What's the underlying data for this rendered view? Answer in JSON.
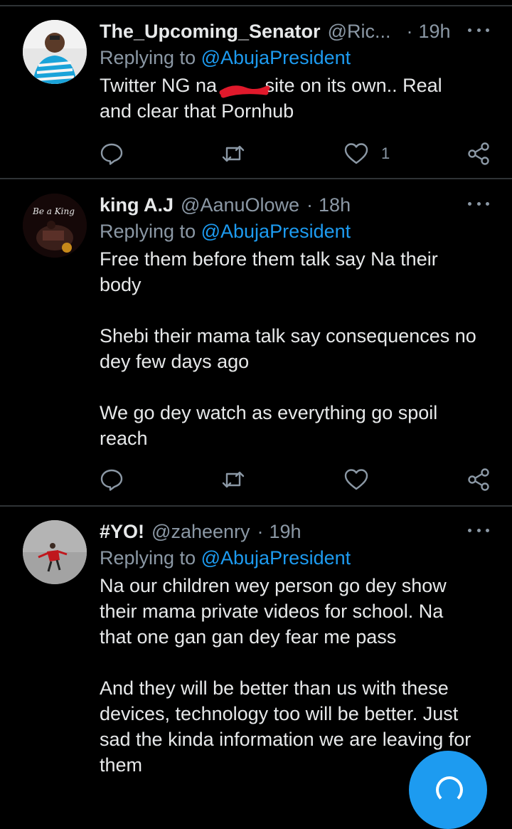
{
  "tweets": [
    {
      "name": "The_Upcoming_Senator",
      "handle": "@Ric...",
      "time": "19h",
      "reply_prefix": "Replying to",
      "reply_to": "@AbujaPresident",
      "body": "Twitter NG na         site on its own.. Real\nand clear that Pornhub",
      "like_count": "1"
    },
    {
      "name": "king A.J",
      "handle": "@AanuOlowe",
      "time": "18h",
      "reply_prefix": "Replying to",
      "reply_to": "@AbujaPresident",
      "body": "Free them before them talk say Na their\nbody\n\nShebi their mama talk say consequences no\ndey few days ago\n\nWe go dey watch as everything go spoil\nreach",
      "avatar_text": "Be a King"
    },
    {
      "name": "#YO!",
      "handle": "@zaheenry",
      "time": "19h",
      "reply_prefix": "Replying to",
      "reply_to": "@AbujaPresident",
      "body": "Na our children wey person go dey show\ntheir mama private videos for school. Na\nthat one gan gan dey fear me pass\n\nAnd they will be better than us with these\ndevices, technology too will be better. Just\nsad the kinda information we are leaving for\nthem"
    }
  ],
  "colors": {
    "background": "#000000",
    "text": "#e7e9ea",
    "muted": "#8b98a5",
    "accent": "#1d9bf0",
    "divider": "#2f3336",
    "redaction": "#e0192b"
  },
  "icons": [
    "comment-icon",
    "retweet-icon",
    "like-icon",
    "share-icon",
    "more-icon",
    "compose-icon"
  ]
}
